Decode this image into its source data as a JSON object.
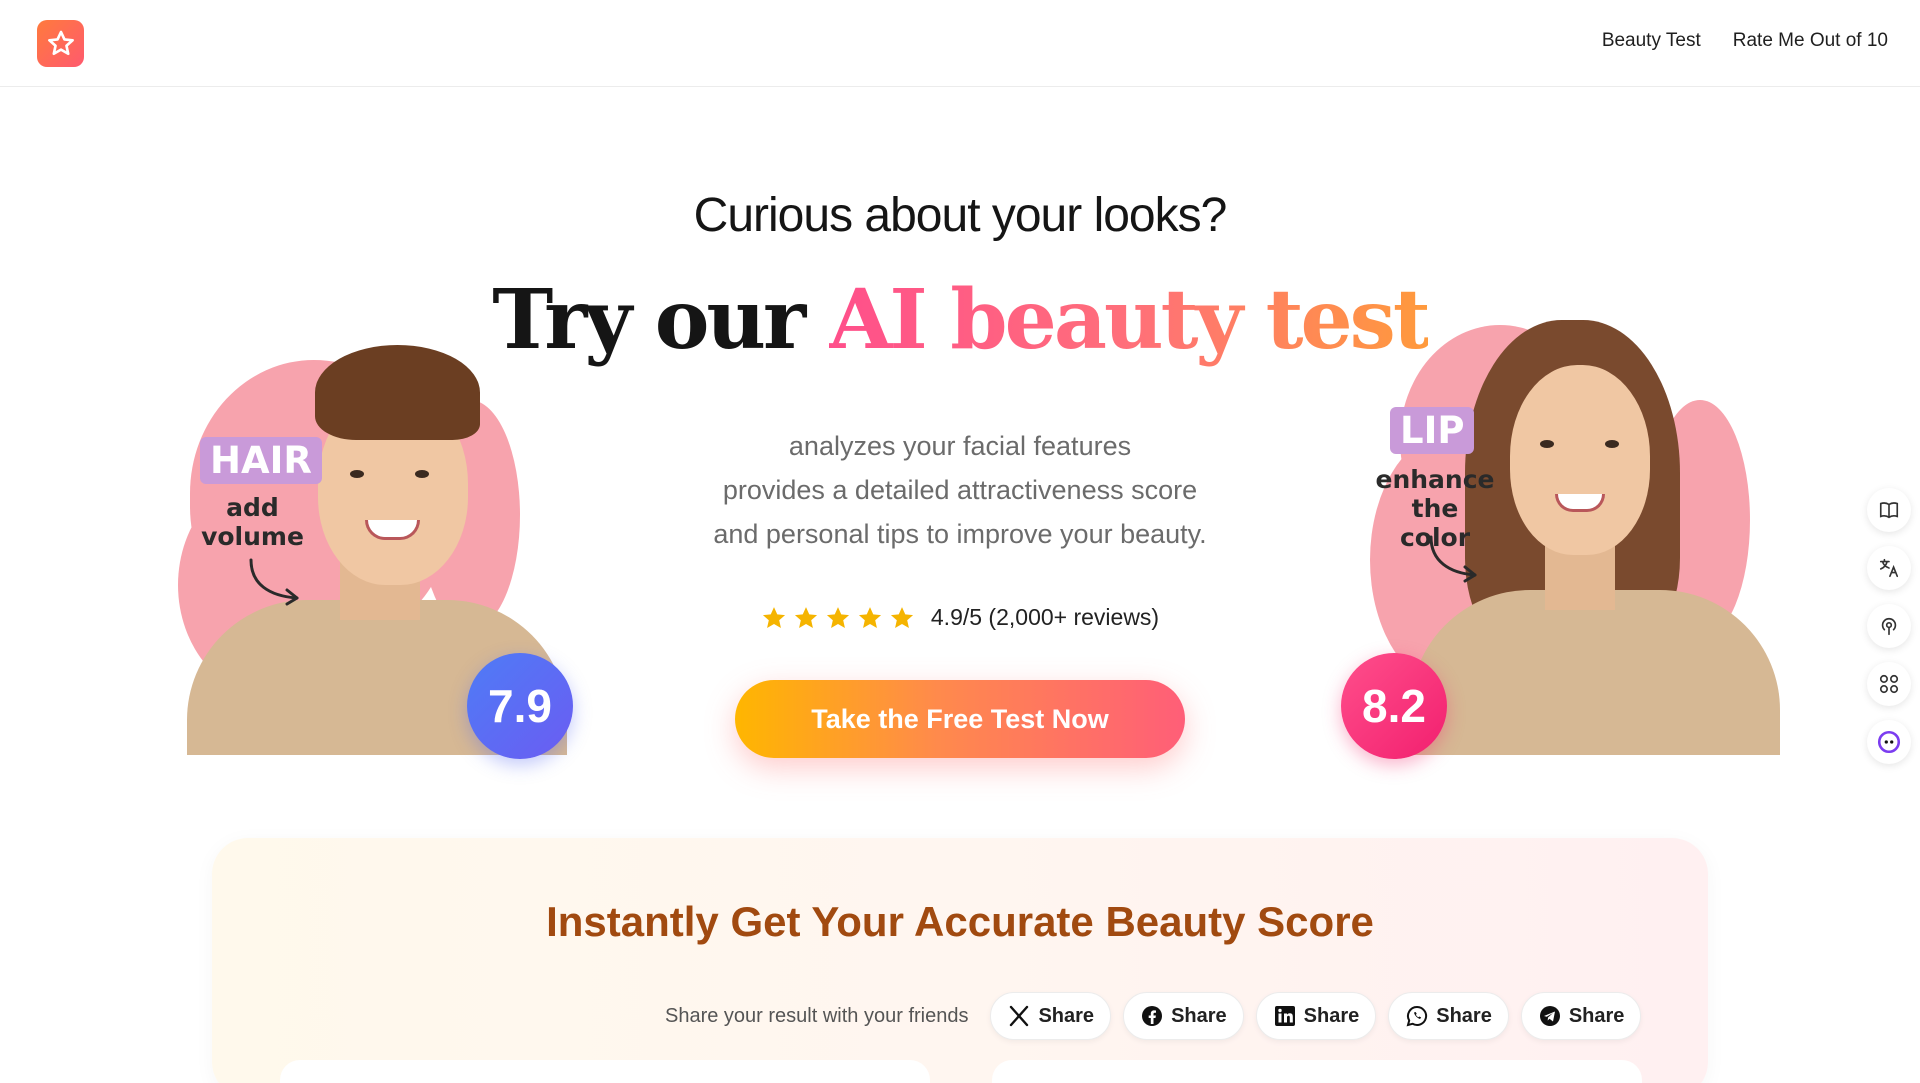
{
  "header": {
    "logo_icon": "star-icon",
    "nav": [
      "Beauty Test",
      "Rate Me Out of 10"
    ]
  },
  "hero": {
    "kicker": "Curious about your looks?",
    "headline_plain": "Try our",
    "headline_accent": "AI beauty test",
    "description": [
      "analyzes your facial features",
      "provides a detailed attractiveness score",
      "and personal tips to improve your beauty."
    ],
    "rating": {
      "stars": 5,
      "text": "4.9/5 (2,000+ reviews)"
    },
    "cta_label": "Take the Free Test Now"
  },
  "left_example": {
    "tag": "HAIR",
    "note_line1": "add",
    "note_line2": "volume",
    "score": "7.9"
  },
  "right_example": {
    "tag": "LIP",
    "note_line1": "enhance",
    "note_line2": "the color",
    "score": "8.2"
  },
  "sidebar": {
    "icons": [
      "book-icon",
      "translate-icon",
      "podcast-icon",
      "apps-icon",
      "assistant-icon"
    ]
  },
  "section": {
    "title": "Instantly Get Your Accurate Beauty Score",
    "share_label": "Share your result with your friends",
    "share_buttons": [
      {
        "icon": "x-icon",
        "label": "Share"
      },
      {
        "icon": "facebook-icon",
        "label": "Share"
      },
      {
        "icon": "linkedin-icon",
        "label": "Share"
      },
      {
        "icon": "whatsapp-icon",
        "label": "Share"
      },
      {
        "icon": "telegram-icon",
        "label": "Share"
      }
    ]
  },
  "colors": {
    "accent_pink": "#ff4f8b",
    "accent_orange": "#ff9a3c",
    "score_blue": "#4e7cf6",
    "score_pink": "#f21f6f",
    "section_title": "#a14a10"
  }
}
